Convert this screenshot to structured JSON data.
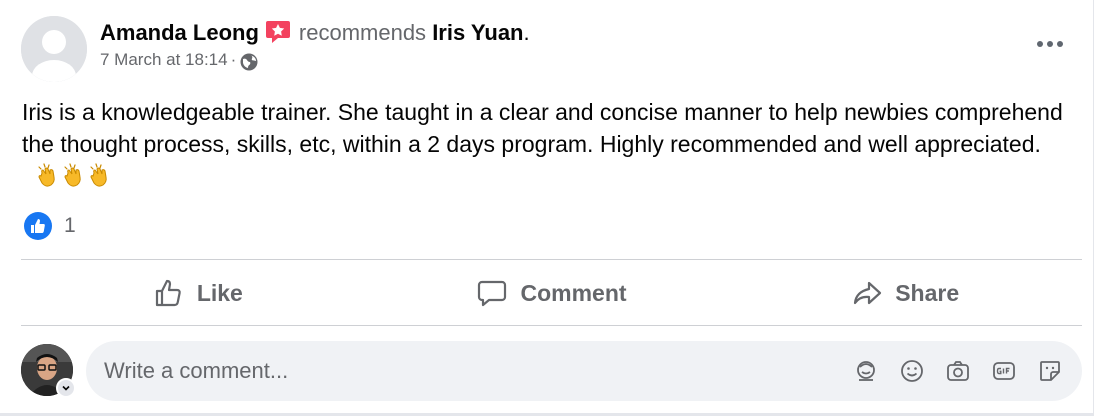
{
  "post": {
    "author": "Amanda Leong",
    "verb": "recommends",
    "target": "Iris Yuan",
    "target_suffix": ".",
    "timestamp": "7 March at 18:14",
    "separator": "·",
    "text_before": "Iris is a knowledgeable trainer.  She taught in a clear and concise manner to help newbies comprehend the thought process, skills, etc, within a 2 days program.  Highly recommended and well appreciated.",
    "emoji_icon": "clapping-hands-icon",
    "emoji_count": 3,
    "privacy_icon": "globe-icon",
    "recommend_icon": "recommend-star-icon"
  },
  "reactions": {
    "icon": "like-thumb-icon",
    "count": "1",
    "color": "#1877f2"
  },
  "actions": {
    "like": "Like",
    "comment": "Comment",
    "share": "Share"
  },
  "composer": {
    "placeholder": "Write a comment...",
    "tools": [
      "avatar-sticker-icon",
      "emoji-icon",
      "camera-icon",
      "gif-icon",
      "sticker-icon"
    ]
  },
  "colors": {
    "secondary_text": "#65676b",
    "divider": "#ced0d4",
    "recommend_badge": "#f3425f",
    "clap": "#f7b928"
  }
}
